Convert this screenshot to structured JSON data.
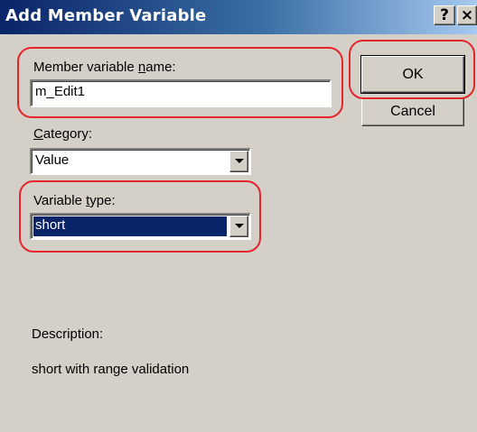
{
  "window": {
    "title": "Add Member Variable",
    "help_glyph": "?",
    "close_glyph": "×"
  },
  "member_name": {
    "label_pre": "Member variable ",
    "label_accel": "n",
    "label_post": "ame:",
    "value": "m_Edit1"
  },
  "category": {
    "label_accel": "C",
    "label_post": "ategory:",
    "selected": "Value"
  },
  "variable_type": {
    "label_pre": "Variable ",
    "label_accel": "t",
    "label_post": "ype:",
    "selected": "short"
  },
  "description": {
    "label": "Description:",
    "text": "short with range validation"
  },
  "buttons": {
    "ok": "OK",
    "cancel": "Cancel"
  },
  "icons": {
    "help": "question-mark-icon",
    "close": "close-icon",
    "dropdown": "chevron-down-icon"
  },
  "colors": {
    "title_start": "#0a246a",
    "title_end": "#a6caf0",
    "dialog_bg": "#d4d0c8",
    "selection": "#0a246a",
    "highlight_ring": "#e8242b"
  }
}
